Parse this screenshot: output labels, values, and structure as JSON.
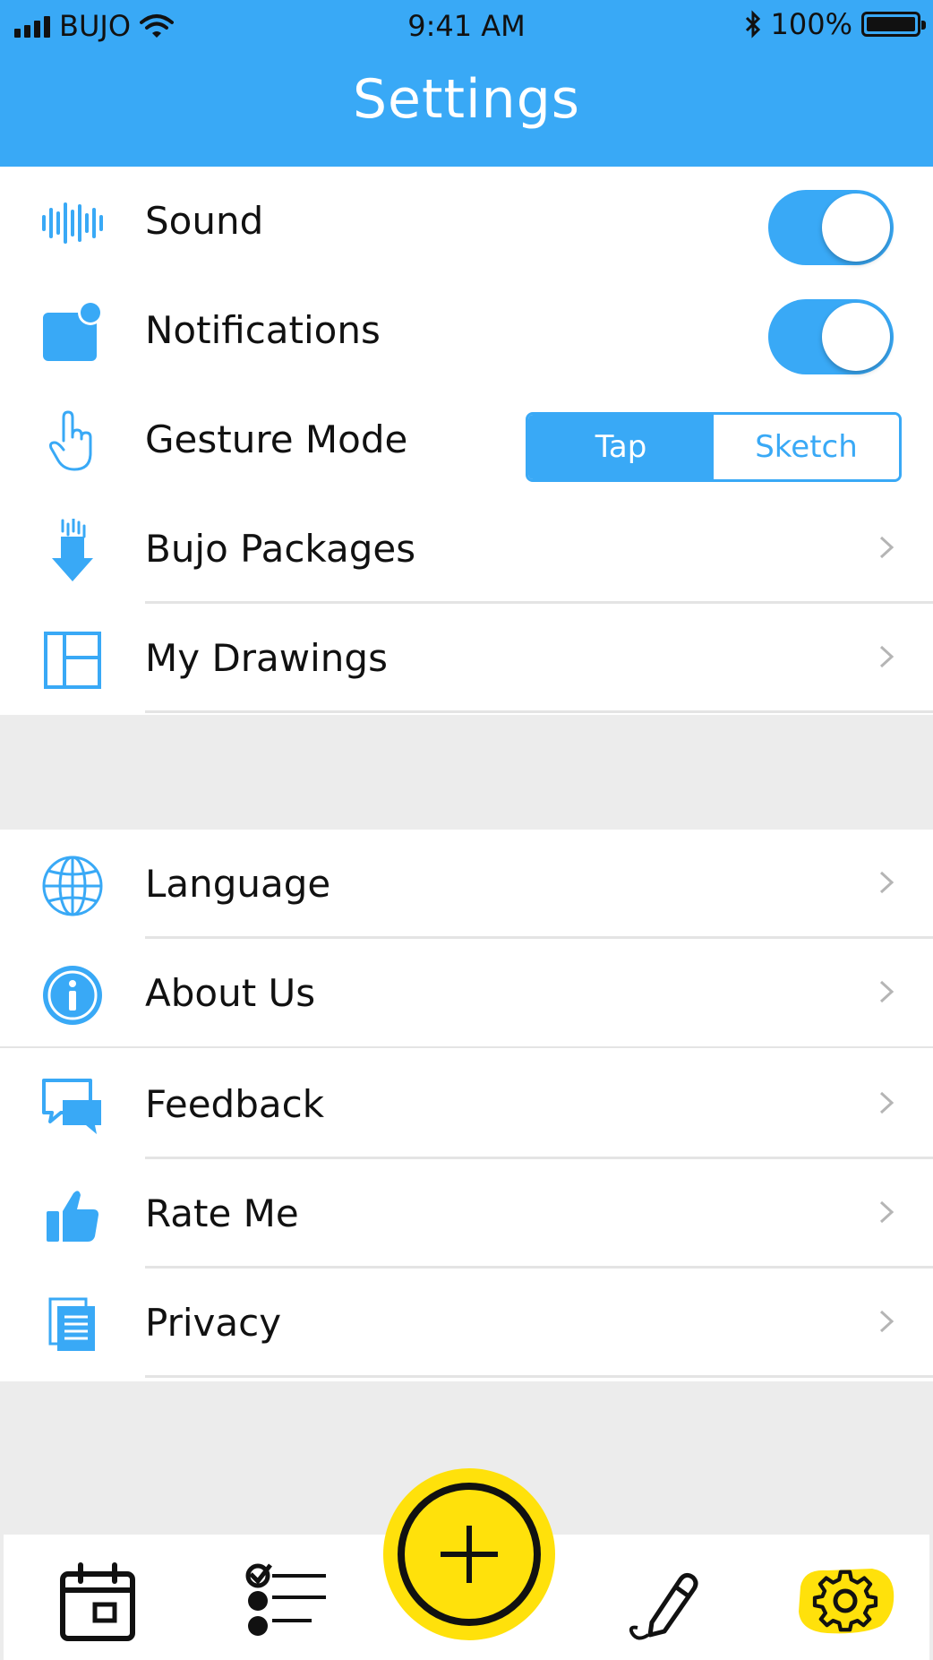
{
  "status_bar": {
    "carrier": "BUJO",
    "time": "9:41 AM",
    "battery": "100%"
  },
  "header": {
    "title": "Settings"
  },
  "section1": {
    "sound": {
      "label": "Sound",
      "on": true
    },
    "notifications": {
      "label": "Notifications",
      "on": true
    },
    "gesture": {
      "label": "Gesture Mode",
      "options": [
        "Tap",
        "Sketch"
      ],
      "selected": "Tap"
    },
    "packages": {
      "label": "Bujo Packages"
    },
    "drawings": {
      "label": "My Drawings"
    }
  },
  "section2": {
    "language": {
      "label": "Language"
    },
    "about": {
      "label": "About Us"
    },
    "feedback": {
      "label": "Feedback"
    },
    "rate": {
      "label": "Rate Me"
    },
    "privacy": {
      "label": "Privacy"
    }
  },
  "tabbar": {
    "tabs": [
      "calendar-icon",
      "checklist-icon",
      "add-icon",
      "pen-icon",
      "gear-icon"
    ],
    "active": "gear-icon"
  },
  "colors": {
    "accent": "#39a9f6",
    "fab": "#ffe10b"
  }
}
